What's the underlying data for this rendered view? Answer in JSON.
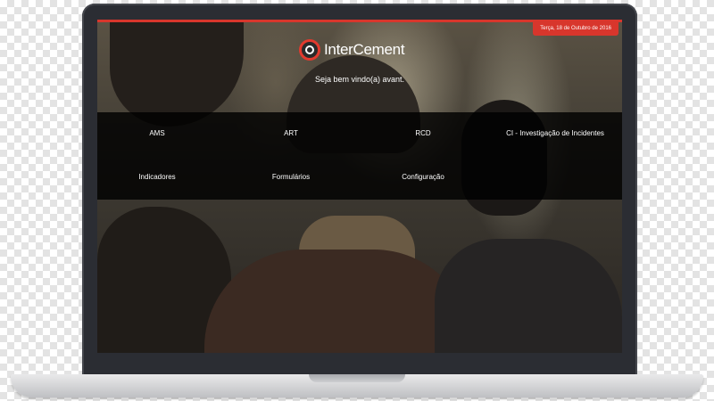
{
  "header": {
    "date": "Terça, 18 de Outubro de 2016",
    "brand": "InterCement",
    "welcome": "Seja bem vindo(a) avant."
  },
  "menu": {
    "row1": [
      "AMS",
      "ART",
      "RCD",
      "CI - Investigação de Incidentes"
    ],
    "row2": [
      "Indicadores",
      "Formulários",
      "Configuração"
    ]
  },
  "colors": {
    "accent": "#d8362c",
    "menu_bg": "#000000",
    "text": "#ffffff"
  },
  "icons": {
    "logo": "intercement-logo-icon"
  }
}
